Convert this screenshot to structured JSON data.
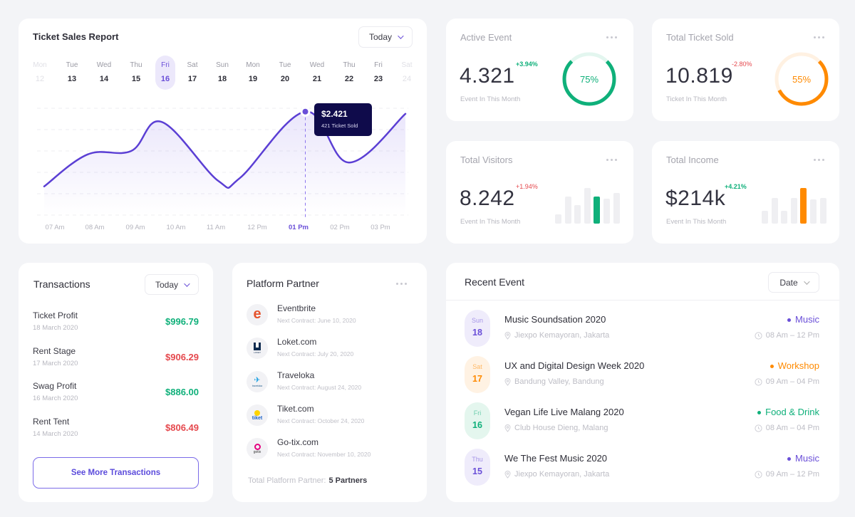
{
  "colors": {
    "purple": "#6a4fd8",
    "green": "#0fb07a",
    "orange": "#ff8a00",
    "red": "#e5484d",
    "navy": "#0f0b4b"
  },
  "ticket_sales": {
    "title": "Ticket Sales Report",
    "dropdown": "Today",
    "days": [
      {
        "name": "Mon",
        "date": "12",
        "state": "faded"
      },
      {
        "name": "Tue",
        "date": "13",
        "state": "normal"
      },
      {
        "name": "Wed",
        "date": "14",
        "state": "normal"
      },
      {
        "name": "Thu",
        "date": "15",
        "state": "normal"
      },
      {
        "name": "Fri",
        "date": "16",
        "state": "active"
      },
      {
        "name": "Sat",
        "date": "17",
        "state": "normal"
      },
      {
        "name": "Sun",
        "date": "18",
        "state": "normal"
      },
      {
        "name": "Mon",
        "date": "19",
        "state": "normal"
      },
      {
        "name": "Tue",
        "date": "20",
        "state": "normal"
      },
      {
        "name": "Wed",
        "date": "21",
        "state": "normal"
      },
      {
        "name": "Thu",
        "date": "22",
        "state": "normal"
      },
      {
        "name": "Fri",
        "date": "23",
        "state": "normal"
      },
      {
        "name": "Sat",
        "date": "24",
        "state": "faded"
      }
    ],
    "tooltip": {
      "value": "$2.421",
      "sub": "421 Ticket Sold"
    }
  },
  "chart_data": {
    "type": "line",
    "title": "Ticket Sales Report",
    "xlabel": "",
    "ylabel": "",
    "x": [
      "07 Am",
      "08 Am",
      "09 Am",
      "10 Am",
      "11 Am",
      "12 Pm",
      "01 Pm",
      "02 Pm",
      "03 Pm"
    ],
    "active_x": "01 Pm",
    "series": [
      {
        "name": "Ticket Sales ($)",
        "x_hours": [
          7.0,
          8.0,
          9.0,
          9.7,
          11.0,
          11.5,
          13.0,
          14.0,
          15.3
        ],
        "values": [
          670,
          1420,
          1500,
          2180,
          800,
          870,
          2421,
          1230,
          2370
        ]
      }
    ],
    "ylim": [
      0,
      2500
    ],
    "grid": true,
    "legend": "none"
  },
  "stats": [
    {
      "id": "active-event",
      "label": "Active Event",
      "value": "4.321",
      "change": "+3.94%",
      "change_color": "#0fb07a",
      "sub": "Event In This Month",
      "ring_percent": 75,
      "ring_label": "75%",
      "ring_color": "#0fb07a",
      "ring_track": "#e3f6ef"
    },
    {
      "id": "total-ticket-sold",
      "label": "Total Ticket Sold",
      "value": "10.819",
      "change": "-2.80%",
      "change_color": "#e5484d",
      "sub": "Ticket In This Month",
      "ring_percent": 55,
      "ring_label": "55%",
      "ring_color": "#ff8a00",
      "ring_track": "#fff1e2"
    },
    {
      "id": "total-visitors",
      "label": "Total Visitors",
      "value": "8.242",
      "change": "+1.94%",
      "change_color": "#e5484d",
      "sub": "Event In This Month",
      "bars": [
        27,
        76,
        53,
        100,
        76,
        71,
        86
      ],
      "highlight_index": 4,
      "bar_color": "#0fb07a"
    },
    {
      "id": "total-income",
      "label": "Total Income",
      "value": "$214k",
      "change": "+4.21%",
      "change_color": "#0fb07a",
      "sub": "Event In This Month",
      "bars": [
        37,
        73,
        37,
        73,
        100,
        68,
        73
      ],
      "highlight_index": 4,
      "bar_color": "#ff8a00"
    }
  ],
  "transactions": {
    "title": "Transactions",
    "dropdown": "Today",
    "items": [
      {
        "name": "Ticket Profit",
        "date": "18 March 2020",
        "amount": "$996.79",
        "type": "income"
      },
      {
        "name": "Rent Stage",
        "date": "17 March 2020",
        "amount": "$906.29",
        "type": "expense"
      },
      {
        "name": "Swag Profit",
        "date": "16 March 2020",
        "amount": "$886.00",
        "type": "income"
      },
      {
        "name": "Rent Tent",
        "date": "14 March 2020",
        "amount": "$806.49",
        "type": "expense"
      }
    ],
    "see_more": "See More Transactions"
  },
  "partners": {
    "title": "Platform Partner",
    "items": [
      {
        "name": "Eventbrite",
        "next": "Next Contract: June 10, 2020",
        "logo": "eventbrite-logo"
      },
      {
        "name": "Loket.com",
        "next": "Next Contract: July 20, 2020",
        "logo": "loket-logo"
      },
      {
        "name": "Traveloka",
        "next": "Next Contract: August 24, 2020",
        "logo": "traveloka-logo"
      },
      {
        "name": "Tiket.com",
        "next": "Next Contract: October 24, 2020",
        "logo": "tiket-logo"
      },
      {
        "name": "Go-tix.com",
        "next": "Next Contract: November 10, 2020",
        "logo": "gotix-logo"
      }
    ],
    "total_label": "Total Platform Partner:",
    "total_value": "5 Partners",
    "logo_text": {
      "loket": "LOKET",
      "traveloka": "traveloka",
      "tiket": "tiket",
      "gotix": "gotix",
      "eventbrite": "e"
    }
  },
  "recent_events": {
    "title": "Recent Event",
    "dropdown": "Date",
    "items": [
      {
        "day": "Sun",
        "date": "18",
        "title": "Music Soundsation 2020",
        "location": "Jiexpo Kemayoran, Jakarta",
        "category": "Music",
        "time": "08 Am – 12 Pm",
        "color": "#6a4fd8",
        "bg": "#efecfb"
      },
      {
        "day": "Sat",
        "date": "17",
        "title": "UX and Digital Design Week 2020",
        "location": "Bandung Valley, Bandung",
        "category": "Workshop",
        "time": "09 Am – 04 Pm",
        "color": "#ff8a00",
        "bg": "#fff2e3"
      },
      {
        "day": "Fri",
        "date": "16",
        "title": "Vegan Life Live Malang 2020",
        "location": "Club House Dieng, Malang",
        "category": "Food & Drink",
        "time": "08 Am – 04 Pm",
        "color": "#0fb07a",
        "bg": "#e4f6ee"
      },
      {
        "day": "Thu",
        "date": "15",
        "title": "We The Fest Music 2020",
        "location": "Jiexpo Kemayoran, Jakarta",
        "category": "Music",
        "time": "09 Am – 12 Pm",
        "color": "#6a4fd8",
        "bg": "#efecfb"
      }
    ]
  }
}
